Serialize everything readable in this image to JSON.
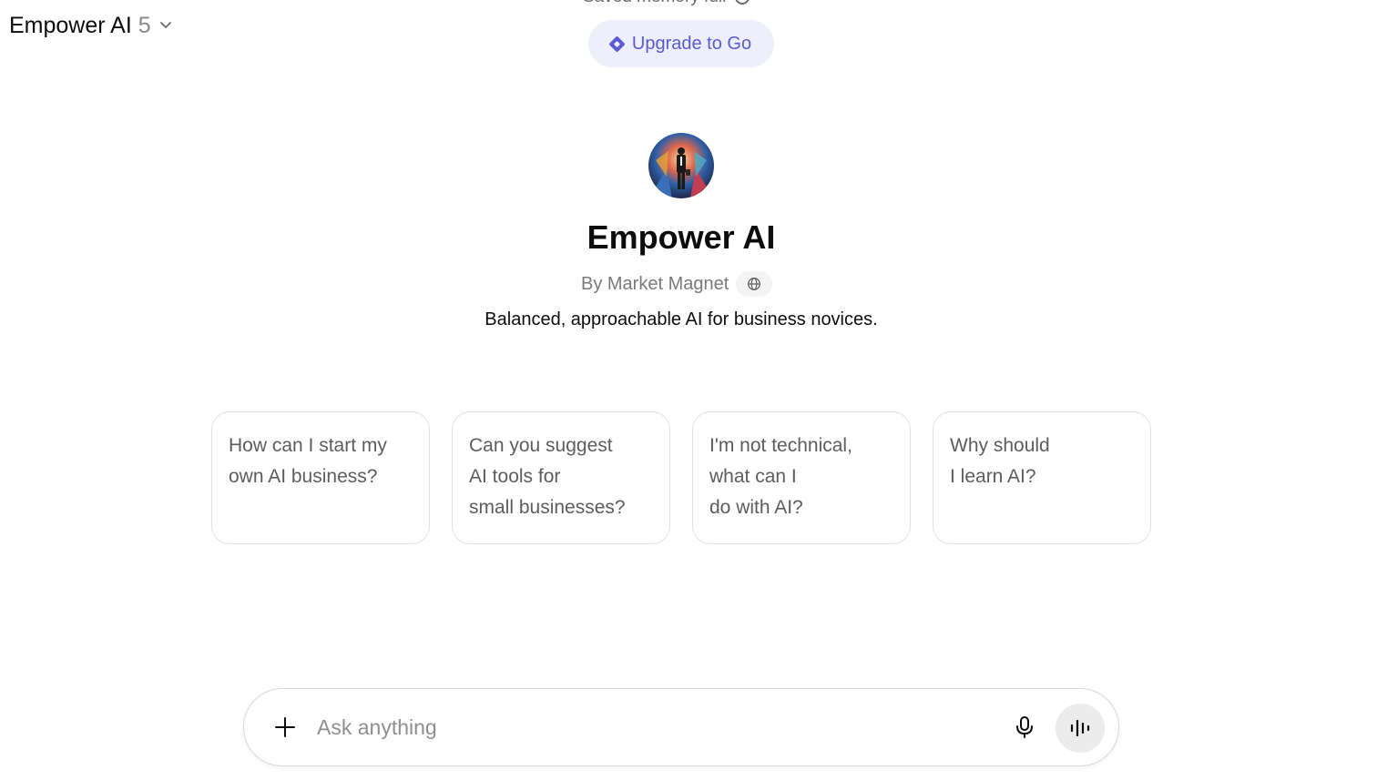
{
  "header": {
    "model_name": "Empower AI",
    "model_version": "5",
    "memory_banner": "Saved memory full",
    "upgrade_label": "Upgrade to Go"
  },
  "gpt": {
    "title": "Empower AI",
    "byline": "By Market Magnet",
    "description": "Balanced, approachable AI for business novices."
  },
  "starters": [
    {
      "lines": [
        "How can I start my",
        "own AI business?"
      ]
    },
    {
      "lines": [
        "Can you suggest",
        "AI tools for",
        "small businesses?"
      ]
    },
    {
      "lines": [
        "I'm not technical,",
        "what can I",
        "do with AI?"
      ]
    },
    {
      "lines": [
        "Why should",
        "I learn AI?"
      ]
    }
  ],
  "composer": {
    "placeholder": "Ask anything"
  },
  "colors": {
    "accent": "#5b5bd6",
    "pill_bg": "#eeeffc"
  },
  "icons": {
    "model_chevron": "chevron-down-icon",
    "upgrade": "diamond-icon",
    "byline_badge": "globe-icon",
    "add": "plus-icon",
    "mic": "microphone-icon",
    "voice": "voice-waveform-icon"
  }
}
